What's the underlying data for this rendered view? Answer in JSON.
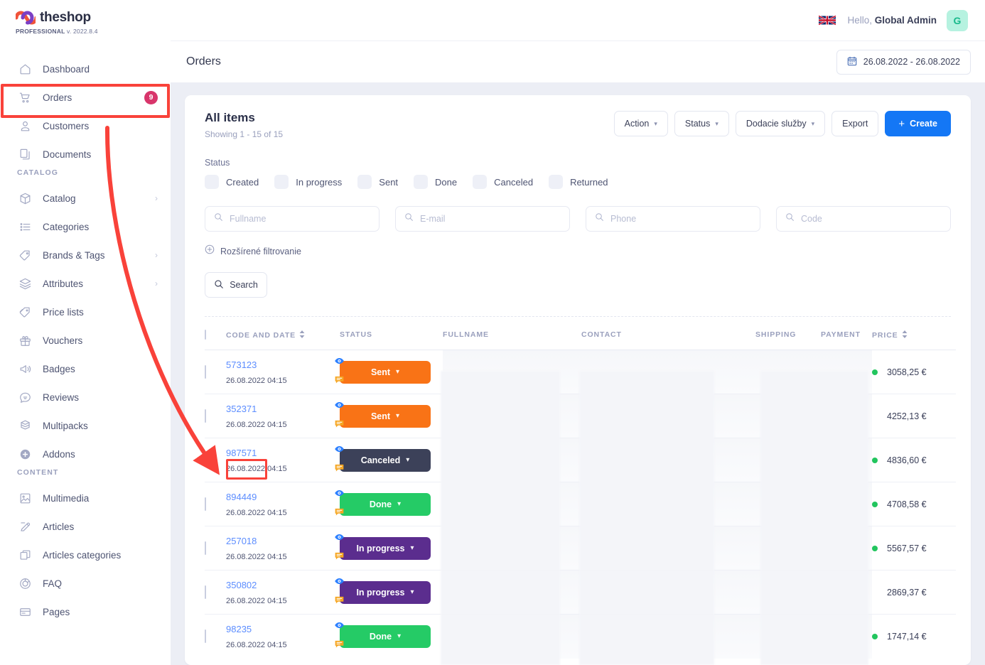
{
  "brand": {
    "name": "theshop",
    "edition": "PROFESSIONAL",
    "version": "v. 2022.8.4"
  },
  "sidebar": {
    "groups": [
      {
        "title": "",
        "items": [
          {
            "label": "Dashboard",
            "icon": "home-icon",
            "badge": "",
            "chevron": false
          },
          {
            "label": "Orders",
            "icon": "cart-icon",
            "badge": "9",
            "chevron": false
          },
          {
            "label": "Customers",
            "icon": "user-icon",
            "badge": "",
            "chevron": false
          },
          {
            "label": "Documents",
            "icon": "documents-icon",
            "badge": "",
            "chevron": false
          }
        ]
      },
      {
        "title": "CATALOG",
        "items": [
          {
            "label": "Catalog",
            "icon": "box-icon",
            "badge": "",
            "chevron": true
          },
          {
            "label": "Categories",
            "icon": "list-icon",
            "badge": "",
            "chevron": false
          },
          {
            "label": "Brands & Tags",
            "icon": "tag-icon",
            "badge": "",
            "chevron": true
          },
          {
            "label": "Attributes",
            "icon": "layers-icon",
            "badge": "",
            "chevron": true
          },
          {
            "label": "Price lists",
            "icon": "pricetag-icon",
            "badge": "",
            "chevron": false
          },
          {
            "label": "Vouchers",
            "icon": "gift-icon",
            "badge": "",
            "chevron": false
          },
          {
            "label": "Badges",
            "icon": "megaphone-icon",
            "badge": "",
            "chevron": false
          },
          {
            "label": "Reviews",
            "icon": "chat-smile-icon",
            "badge": "",
            "chevron": false
          },
          {
            "label": "Multipacks",
            "icon": "multipack-icon",
            "badge": "",
            "chevron": false
          },
          {
            "label": "Addons",
            "icon": "plus-circle-icon",
            "badge": "",
            "chevron": false
          }
        ]
      },
      {
        "title": "CONTENT",
        "items": [
          {
            "label": "Multimedia",
            "icon": "image-icon",
            "badge": "",
            "chevron": false
          },
          {
            "label": "Articles",
            "icon": "pencil-icon",
            "badge": "",
            "chevron": false
          },
          {
            "label": "Articles categories",
            "icon": "copy-icon",
            "badge": "",
            "chevron": false
          },
          {
            "label": "FAQ",
            "icon": "faq-icon",
            "badge": "",
            "chevron": false
          },
          {
            "label": "Pages",
            "icon": "page-icon",
            "badge": "",
            "chevron": false
          }
        ]
      }
    ]
  },
  "topbar": {
    "flag": "uk-flag-icon",
    "greeting_prefix": "Hello,",
    "user_name": "Global Admin",
    "avatar_initial": "G"
  },
  "pagehead": {
    "title": "Orders",
    "date_range": "26.08.2022 - 26.08.2022",
    "calendar_icon": "calendar-icon"
  },
  "card": {
    "heading": "All items",
    "showing": "Showing 1 - 15 of 15",
    "buttons": [
      {
        "label": "Action",
        "caret": true
      },
      {
        "label": "Status",
        "caret": true
      },
      {
        "label": "Dodacie služby",
        "caret": true
      },
      {
        "label": "Export",
        "caret": false
      }
    ],
    "create_label": "Create",
    "create_plus": "+",
    "create_color": "#1477f5"
  },
  "status_filter": {
    "label": "Status",
    "options": [
      "Created",
      "In progress",
      "Sent",
      "Done",
      "Canceled",
      "Returned"
    ]
  },
  "filters": [
    {
      "placeholder": "Fullname",
      "value": "",
      "name": "fullname"
    },
    {
      "placeholder": "E-mail",
      "value": "",
      "name": "email"
    },
    {
      "placeholder": "Phone",
      "value": "",
      "name": "phone"
    },
    {
      "placeholder": "Code",
      "value": "",
      "name": "code"
    }
  ],
  "advanced_filter_label": "Rozšírené filtrovanie",
  "search_label": "Search",
  "table": {
    "columns": [
      {
        "label": "CODE AND DATE",
        "sortable": true
      },
      {
        "label": "STATUS",
        "sortable": false
      },
      {
        "label": "FULLNAME",
        "sortable": false
      },
      {
        "label": "CONTACT",
        "sortable": false
      },
      {
        "label": "SHIPPING",
        "sortable": false
      },
      {
        "label": "PAYMENT",
        "sortable": false
      },
      {
        "label": "PRICE",
        "sortable": true
      }
    ],
    "rows": [
      {
        "code": "573123",
        "date": "26.08.2022 04:15",
        "status": "Sent",
        "status_color": "#f97316",
        "price": "3058,25 €",
        "paid": true
      },
      {
        "code": "352371",
        "date": "26.08.2022 04:15",
        "status": "Sent",
        "status_color": "#f97316",
        "price": "4252,13 €",
        "paid": false
      },
      {
        "code": "987571",
        "date": "26.08.2022 04:15",
        "status": "Canceled",
        "status_color": "#3c4159",
        "price": "4836,60 €",
        "paid": true
      },
      {
        "code": "894449",
        "date": "26.08.2022 04:15",
        "status": "Done",
        "status_color": "#25cb66",
        "price": "4708,58 €",
        "paid": true
      },
      {
        "code": "257018",
        "date": "26.08.2022 04:15",
        "status": "In progress",
        "status_color": "#5b2d8e",
        "price": "5567,57 €",
        "paid": true
      },
      {
        "code": "350802",
        "date": "26.08.2022 04:15",
        "status": "In progress",
        "status_color": "#5b2d8e",
        "price": "2869,37 €",
        "paid": false
      },
      {
        "code": "98235",
        "date": "26.08.2022 04:15",
        "status": "Done",
        "status_color": "#25cb66",
        "price": "1747,14 €",
        "paid": true
      }
    ],
    "row_icons": [
      "eye-icon",
      "comment-icon"
    ],
    "eye_color": "#2b7fff",
    "comment_color": "#f5a623",
    "paid_dot_color": "#22c55e"
  },
  "annotations": {
    "highlight_color": "#f9423a",
    "rect_orders_target": "Orders",
    "rect_code_target": "987571"
  }
}
